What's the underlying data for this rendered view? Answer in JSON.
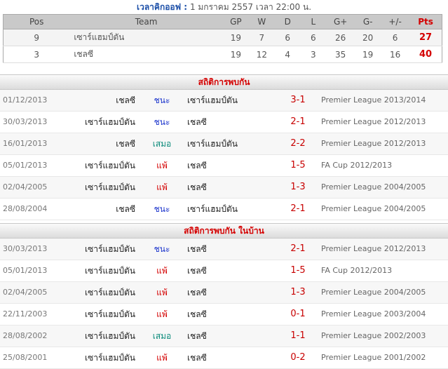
{
  "kickoff": {
    "label": "เวลาคิกออฟ :",
    "value": "1 มกราคม 2557 เวลา 22:00 น."
  },
  "standings": {
    "headers": [
      "Pos",
      "Team",
      "GP",
      "W",
      "D",
      "L",
      "G+",
      "G-",
      "+/-",
      "Pts"
    ],
    "rows": [
      [
        "9",
        "เซาร์แฮมป์ตัน",
        "19",
        "7",
        "6",
        "6",
        "26",
        "20",
        "6",
        "27"
      ],
      [
        "3",
        "เชลซี",
        "19",
        "12",
        "4",
        "3",
        "35",
        "19",
        "16",
        "40"
      ]
    ]
  },
  "h2h": {
    "title": "สถิติการพบกัน",
    "rows": [
      {
        "date": "01/12/2013",
        "home": "เชลซี",
        "result": "ชนะ",
        "type": "win",
        "away": "เซาร์แฮมป์ตัน",
        "score": "3-1",
        "comp": "Premier League 2013/2014"
      },
      {
        "date": "30/03/2013",
        "home": "เซาร์แฮมป์ตัน",
        "result": "ชนะ",
        "type": "win",
        "away": "เชลซี",
        "score": "2-1",
        "comp": "Premier League 2012/2013"
      },
      {
        "date": "16/01/2013",
        "home": "เชลซี",
        "result": "เสมอ",
        "type": "draw",
        "away": "เซาร์แฮมป์ตัน",
        "score": "2-2",
        "comp": "Premier League 2012/2013"
      },
      {
        "date": "05/01/2013",
        "home": "เซาร์แฮมป์ตัน",
        "result": "แพ้",
        "type": "lose",
        "away": "เชลซี",
        "score": "1-5",
        "comp": "FA Cup 2012/2013"
      },
      {
        "date": "02/04/2005",
        "home": "เซาร์แฮมป์ตัน",
        "result": "แพ้",
        "type": "lose",
        "away": "เชลซี",
        "score": "1-3",
        "comp": "Premier League 2004/2005"
      },
      {
        "date": "28/08/2004",
        "home": "เชลซี",
        "result": "ชนะ",
        "type": "win",
        "away": "เซาร์แฮมป์ตัน",
        "score": "2-1",
        "comp": "Premier League 2004/2005"
      }
    ]
  },
  "h2h_home": {
    "title": "สถิติการพบกัน ในบ้าน",
    "rows": [
      {
        "date": "30/03/2013",
        "home": "เซาร์แฮมป์ตัน",
        "result": "ชนะ",
        "type": "win",
        "away": "เชลซี",
        "score": "2-1",
        "comp": "Premier League 2012/2013"
      },
      {
        "date": "05/01/2013",
        "home": "เซาร์แฮมป์ตัน",
        "result": "แพ้",
        "type": "lose",
        "away": "เชลซี",
        "score": "1-5",
        "comp": "FA Cup 2012/2013"
      },
      {
        "date": "02/04/2005",
        "home": "เซาร์แฮมป์ตัน",
        "result": "แพ้",
        "type": "lose",
        "away": "เชลซี",
        "score": "1-3",
        "comp": "Premier League 2004/2005"
      },
      {
        "date": "22/11/2003",
        "home": "เซาร์แฮมป์ตัน",
        "result": "แพ้",
        "type": "lose",
        "away": "เชลซี",
        "score": "0-1",
        "comp": "Premier League 2003/2004"
      },
      {
        "date": "28/08/2002",
        "home": "เซาร์แฮมป์ตัน",
        "result": "เสมอ",
        "type": "draw",
        "away": "เชลซี",
        "score": "1-1",
        "comp": "Premier League 2002/2003"
      },
      {
        "date": "25/08/2001",
        "home": "เซาร์แฮมป์ตัน",
        "result": "แพ้",
        "type": "lose",
        "away": "เชลซี",
        "score": "0-2",
        "comp": "Premier League 2001/2002"
      }
    ]
  }
}
